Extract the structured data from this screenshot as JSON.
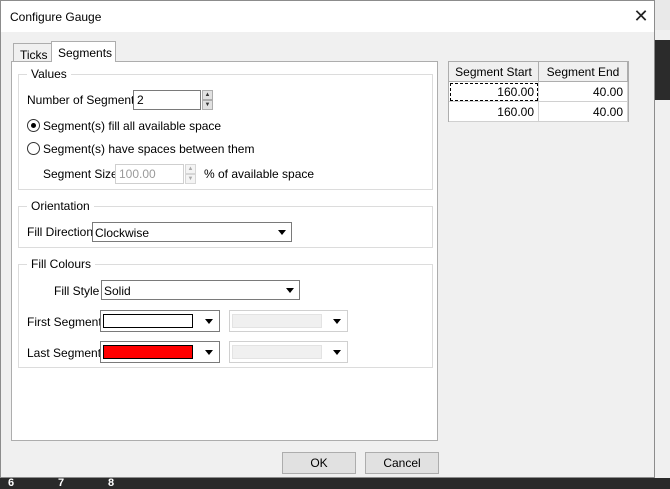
{
  "window": {
    "title": "Configure Gauge"
  },
  "tabs": [
    {
      "label": "Ticks",
      "active": false
    },
    {
      "label": "Segments",
      "active": true
    }
  ],
  "values": {
    "legend": "Values",
    "num_segments_label": "Number of Segments",
    "num_segments_value": "2",
    "radio_fill": "Segment(s) fill all available space",
    "radio_spaces": "Segment(s) have spaces between them",
    "radio_selected": "fill",
    "segment_size_label": "Segment Size",
    "segment_size_value": "100.00",
    "segment_size_suffix": "% of available space"
  },
  "orientation": {
    "legend": "Orientation",
    "fill_direction_label": "Fill Direction",
    "fill_direction_value": "Clockwise"
  },
  "fill_colours": {
    "legend": "Fill Colours",
    "fill_style_label": "Fill Style",
    "fill_style_value": "Solid",
    "first_segment_label": "First Segment",
    "first_segment_color": "#ffffff",
    "last_segment_label": "Last Segment",
    "last_segment_color": "#ff0000",
    "disabled_swatch_color": "#f0f0f0"
  },
  "segment_table": {
    "headers": [
      "Segment Start",
      "Segment End"
    ],
    "rows": [
      [
        "160.00",
        "40.00"
      ],
      [
        "160.00",
        "40.00"
      ]
    ]
  },
  "buttons": {
    "ok": "OK",
    "cancel": "Cancel"
  },
  "background": {
    "bottom_numbers": [
      "6",
      "7",
      "8"
    ]
  }
}
